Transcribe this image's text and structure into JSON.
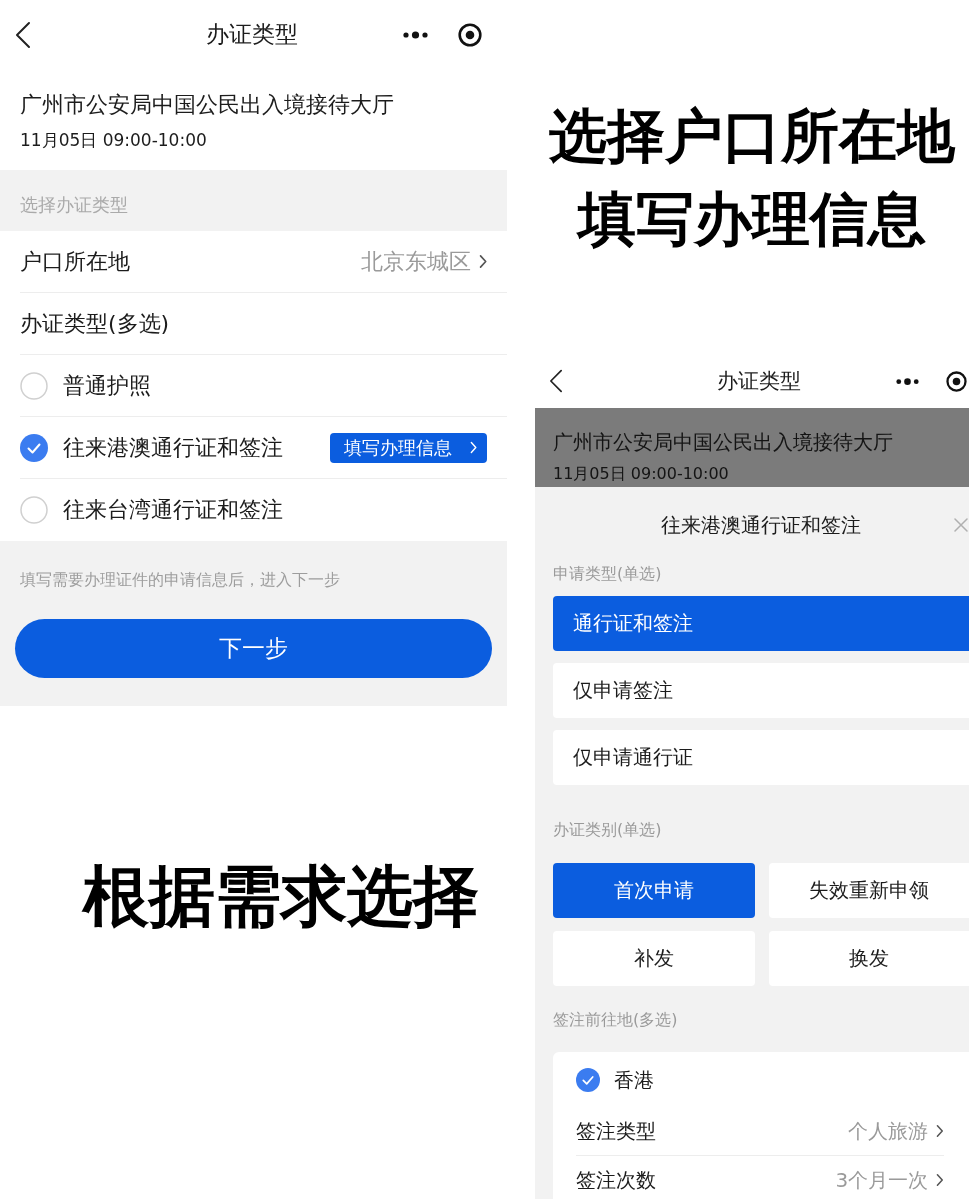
{
  "left_screen": {
    "nav_bar": {
      "title": "办证类型"
    },
    "venue": {
      "name": "广州市公安局中国公民出入境接待大厅",
      "time": "11月05日 09:00-10:00"
    },
    "section_label": "选择办证类型",
    "household": {
      "label": "户口所在地",
      "value": "北京东城区"
    },
    "document_types": {
      "label": "办证类型(多选)",
      "items": [
        {
          "label": "普通护照",
          "checked": false
        },
        {
          "label": "往来港澳通行证和签注",
          "checked": true,
          "action": "填写办理信息"
        },
        {
          "label": "往来台湾通行证和签注",
          "checked": false
        }
      ]
    },
    "hint": "填写需要办理证件的申请信息后，进入下一步",
    "next_button": "下一步"
  },
  "caption_right": {
    "lines": [
      "选择户口所在地",
      "填写办理信息"
    ]
  },
  "caption_left": "根据需求选择",
  "right_screen": {
    "nav_bar": {
      "title": "办证类型"
    },
    "venue": {
      "name": "广州市公安局中国公民出入境接待大厅",
      "time": "11月05日 09:00-10:00",
      "dimmed": true
    },
    "sheet": {
      "title": "往来港澳通行证和签注",
      "application_type": {
        "label": "申请类型(单选)",
        "options": [
          {
            "label": "通行证和签注",
            "selected": true
          },
          {
            "label": "仅申请签注",
            "selected": false
          },
          {
            "label": "仅申请通行证",
            "selected": false
          }
        ]
      },
      "category": {
        "label": "办证类别(单选)",
        "options": [
          {
            "label": "首次申请",
            "selected": true
          },
          {
            "label": "失效重新申领",
            "selected": false
          },
          {
            "label": "补发",
            "selected": false
          },
          {
            "label": "换发",
            "selected": false
          }
        ]
      },
      "destinations": {
        "label": "签注前往地(多选)",
        "items": [
          {
            "name": "香港",
            "checked": true,
            "fields": [
              {
                "label": "签注类型",
                "value": "个人旅游"
              },
              {
                "label": "签注次数",
                "value": "3个月一次"
              }
            ]
          }
        ]
      }
    }
  }
}
